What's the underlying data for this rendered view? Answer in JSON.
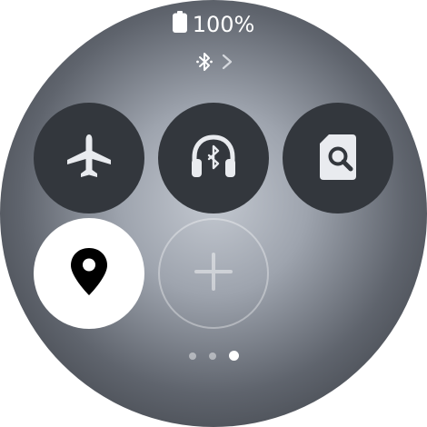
{
  "status": {
    "battery_text": "100%",
    "battery_icon": "battery-full-icon"
  },
  "bluetooth": {
    "icon": "bluetooth-icon",
    "chevron": "chevron-right-icon"
  },
  "tiles": [
    {
      "name": "airplane-mode",
      "icon": "airplane-icon",
      "active": false
    },
    {
      "name": "bluetooth-audio",
      "icon": "headphones-bluetooth-icon",
      "active": false
    },
    {
      "name": "find-my-phone",
      "icon": "find-phone-icon",
      "active": false
    },
    {
      "name": "location",
      "icon": "location-pin-icon",
      "active": true
    },
    {
      "name": "add-tile",
      "icon": "plus-icon",
      "active": false
    }
  ],
  "pager": {
    "total_pages": 3,
    "current_page": 3
  },
  "colors": {
    "tile_bg": "#33373d",
    "tile_active_bg": "#ffffff",
    "icon_color": "#e9ebef"
  }
}
